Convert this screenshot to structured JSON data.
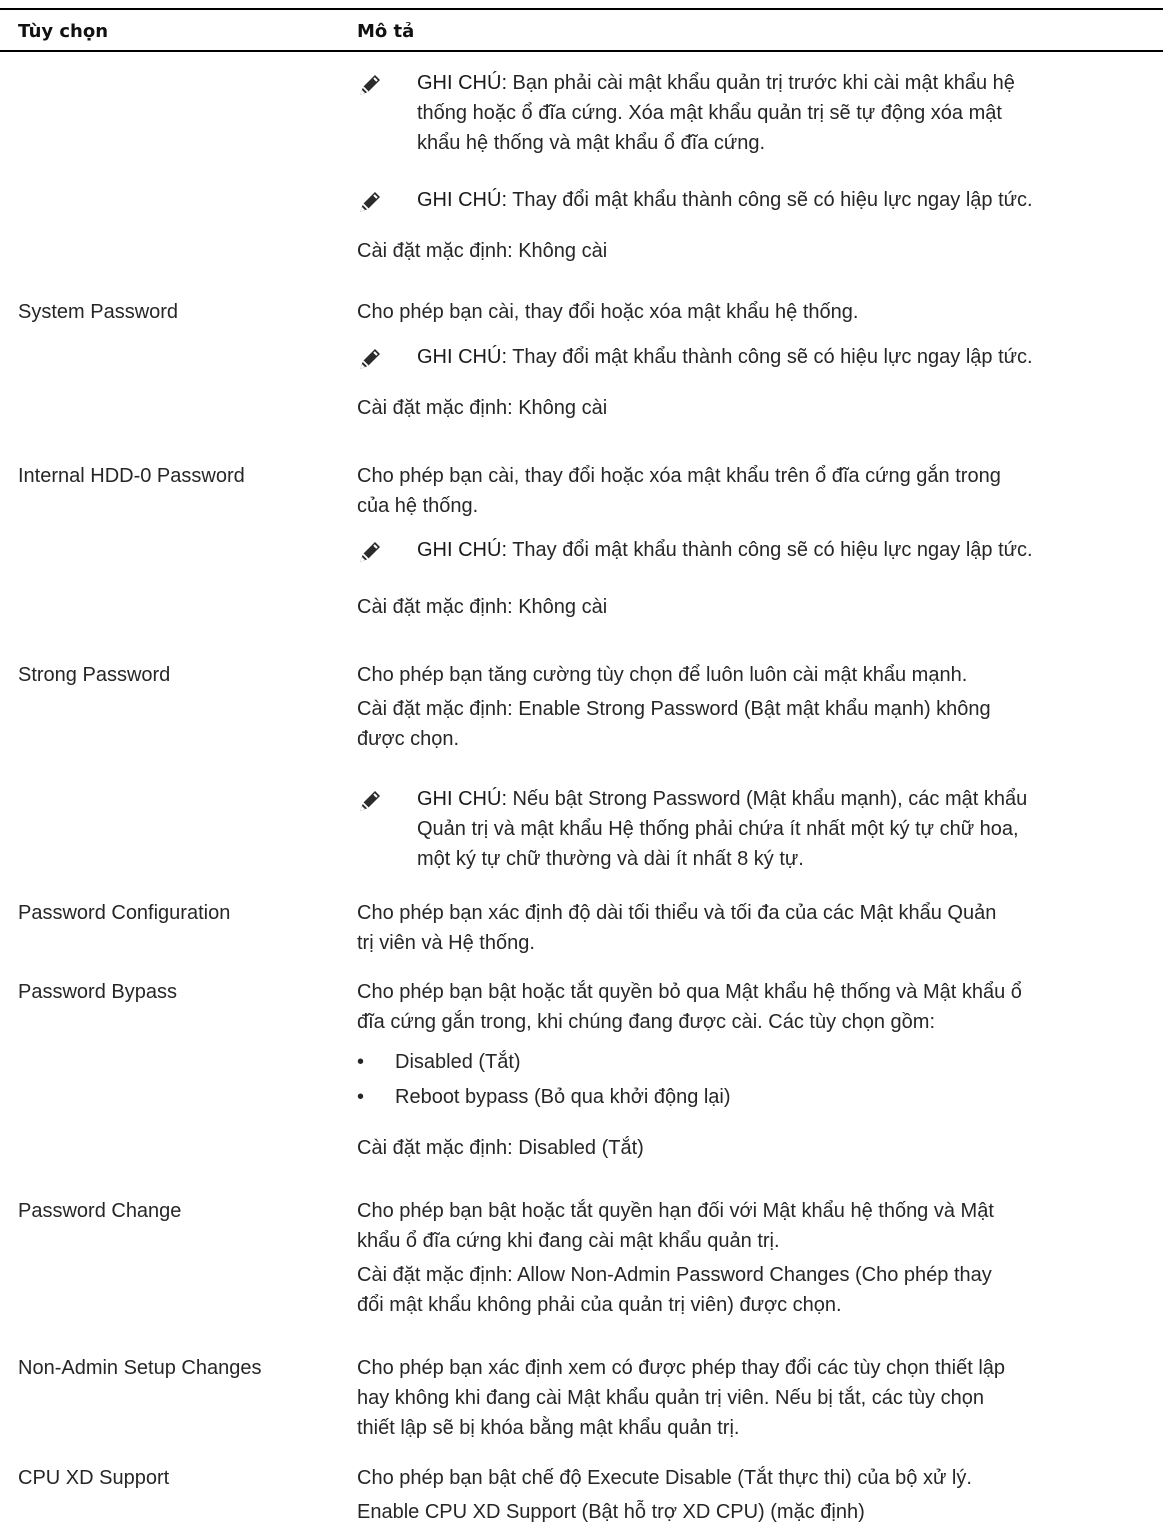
{
  "header": {
    "col1": "Tùy chọn",
    "col2": "Mô tả"
  },
  "icon_name": "note-pencil-icon",
  "note_label": "GHI CHÚ:",
  "bullet_glyph": "•",
  "rows": {
    "admin": {
      "note1": [
        " Bạn phải cài mật khẩu quản trị trước khi cài mật khẩu hệ",
        "thống hoặc ổ đĩa cứng. Xóa mật khẩu quản trị sẽ tự động xóa mật",
        "khẩu hệ thống và mật khẩu ổ đĩa cứng."
      ],
      "note2": " Thay đổi mật khẩu thành công sẽ có hiệu lực ngay lập tức.",
      "default": "Cài đặt mặc định: Không cài"
    },
    "system_password": {
      "option": "System Password",
      "desc": "Cho phép bạn cài, thay đổi hoặc xóa mật khẩu hệ thống.",
      "note": " Thay đổi mật khẩu thành công sẽ có hiệu lực ngay lập tức.",
      "default": "Cài đặt mặc định: Không cài"
    },
    "internal_hdd": {
      "option": "Internal HDD-0 Password",
      "desc": [
        "Cho phép bạn cài, thay đổi hoặc xóa mật khẩu trên ổ đĩa cứng gắn trong",
        "của hệ thống."
      ],
      "note": " Thay đổi mật khẩu thành công sẽ có hiệu lực ngay lập tức.",
      "default": "Cài đặt mặc định: Không cài"
    },
    "strong_password": {
      "option": "Strong Password",
      "desc": "Cho phép bạn tăng cường tùy chọn để luôn luôn cài mật khẩu mạnh.",
      "default": [
        "Cài đặt mặc định: Enable Strong Password (Bật mật khẩu mạnh) không",
        "được chọn."
      ],
      "note": [
        " Nếu bật Strong Password (Mật khẩu mạnh), các mật khẩu",
        "Quản trị và mật khẩu Hệ thống phải chứa ít nhất một ký tự chữ hoa,",
        "một ký tự chữ thường và dài ít nhất 8 ký tự."
      ]
    },
    "password_config": {
      "option": "Password Configuration",
      "desc": [
        "Cho phép bạn xác định độ dài tối thiểu và tối đa của các Mật khẩu Quản",
        "trị viên và Hệ thống."
      ]
    },
    "password_bypass": {
      "option": "Password Bypass",
      "desc": [
        "Cho phép bạn bật hoặc tắt quyền bỏ qua Mật khẩu hệ thống và Mật khẩu ổ",
        "đĩa cứng gắn trong, khi chúng đang được cài. Các tùy chọn gồm:"
      ],
      "bullets": [
        "Disabled (Tắt)",
        "Reboot bypass (Bỏ qua khởi động lại)"
      ],
      "default": "Cài đặt mặc định: Disabled (Tắt)"
    },
    "password_change": {
      "option": "Password Change",
      "desc": [
        "Cho phép bạn bật hoặc tắt quyền hạn đối với Mật khẩu hệ thống và Mật",
        "khẩu ổ đĩa cứng khi đang cài mật khẩu quản trị."
      ],
      "default": [
        "Cài đặt mặc định: Allow Non-Admin Password Changes (Cho phép thay",
        "đổi mật khẩu không phải của quản trị viên) được chọn."
      ]
    },
    "non_admin": {
      "option": "Non-Admin Setup Changes",
      "desc": [
        "Cho phép bạn xác định xem có được phép thay đổi các tùy chọn thiết lập",
        "hay không khi đang cài Mật khẩu quản trị viên. Nếu bị tắt, các tùy chọn",
        "thiết lập sẽ bị khóa bằng mật khẩu quản trị."
      ]
    },
    "cpu_xd": {
      "option": "CPU XD Support",
      "desc": "Cho phép bạn bật chế độ Execute Disable (Tắt thực thi) của bộ xử lý.",
      "default": "Enable CPU XD Support (Bật hỗ trợ XD CPU) (mặc định)"
    }
  }
}
